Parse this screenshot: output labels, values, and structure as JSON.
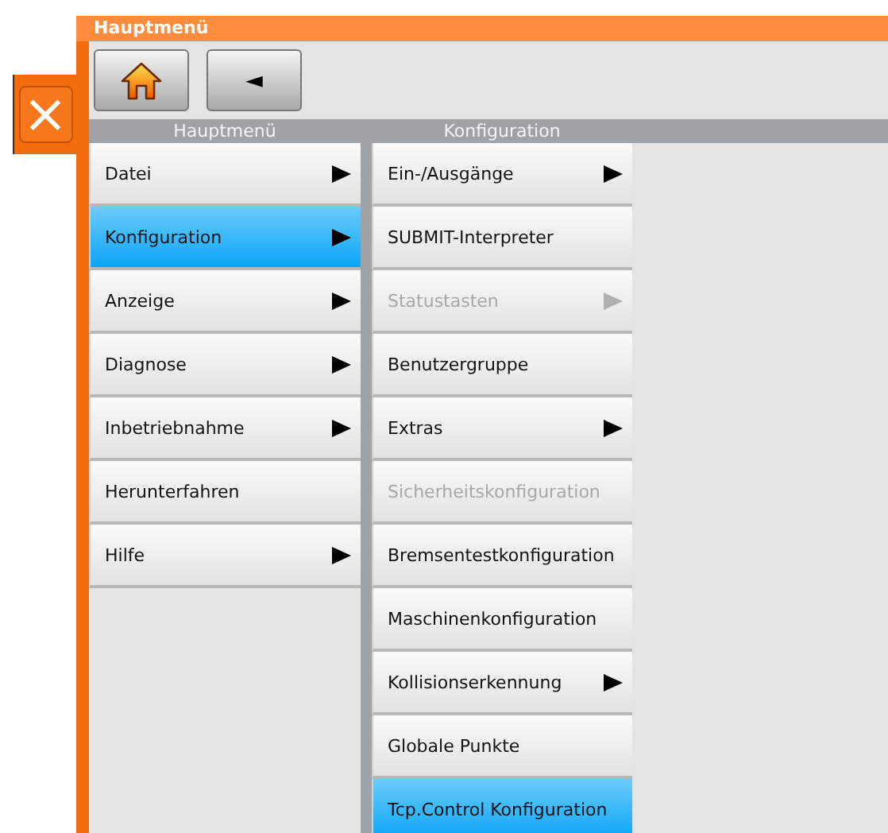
{
  "window": {
    "title": "Hauptmenü"
  },
  "close_button": {
    "label": "×"
  },
  "toolbar": {
    "back_button": {
      "label": "◄"
    }
  },
  "columns": [
    {
      "header": "Hauptmenü",
      "items": [
        {
          "label": "Datei",
          "submenu": true,
          "selected": false,
          "disabled": false
        },
        {
          "label": "Konfiguration",
          "submenu": true,
          "selected": true,
          "disabled": false
        },
        {
          "label": "Anzeige",
          "submenu": true,
          "selected": false,
          "disabled": false
        },
        {
          "label": "Diagnose",
          "submenu": true,
          "selected": false,
          "disabled": false
        },
        {
          "label": "Inbetriebnahme",
          "submenu": true,
          "selected": false,
          "disabled": false
        },
        {
          "label": "Herunterfahren",
          "submenu": false,
          "selected": false,
          "disabled": false
        },
        {
          "label": "Hilfe",
          "submenu": true,
          "selected": false,
          "disabled": false
        }
      ]
    },
    {
      "header": "Konfiguration",
      "items": [
        {
          "label": "Ein-/Ausgänge",
          "submenu": true,
          "selected": false,
          "disabled": false
        },
        {
          "label": "SUBMIT-Interpreter",
          "submenu": false,
          "selected": false,
          "disabled": false
        },
        {
          "label": "Statustasten",
          "submenu": true,
          "selected": false,
          "disabled": true
        },
        {
          "label": "Benutzergruppe",
          "submenu": false,
          "selected": false,
          "disabled": false
        },
        {
          "label": "Extras",
          "submenu": true,
          "selected": false,
          "disabled": false
        },
        {
          "label": "Sicherheitskonfiguration",
          "submenu": false,
          "selected": false,
          "disabled": true
        },
        {
          "label": "Bremsentestkonfiguration",
          "submenu": false,
          "selected": false,
          "disabled": false
        },
        {
          "label": "Maschinenkonfiguration",
          "submenu": false,
          "selected": false,
          "disabled": false
        },
        {
          "label": "Kollisionserkennung",
          "submenu": true,
          "selected": false,
          "disabled": false
        },
        {
          "label": "Globale Punkte",
          "submenu": false,
          "selected": false,
          "disabled": false
        },
        {
          "label": "Tcp.Control Konfiguration",
          "submenu": false,
          "selected": true,
          "disabled": false
        }
      ]
    }
  ]
}
